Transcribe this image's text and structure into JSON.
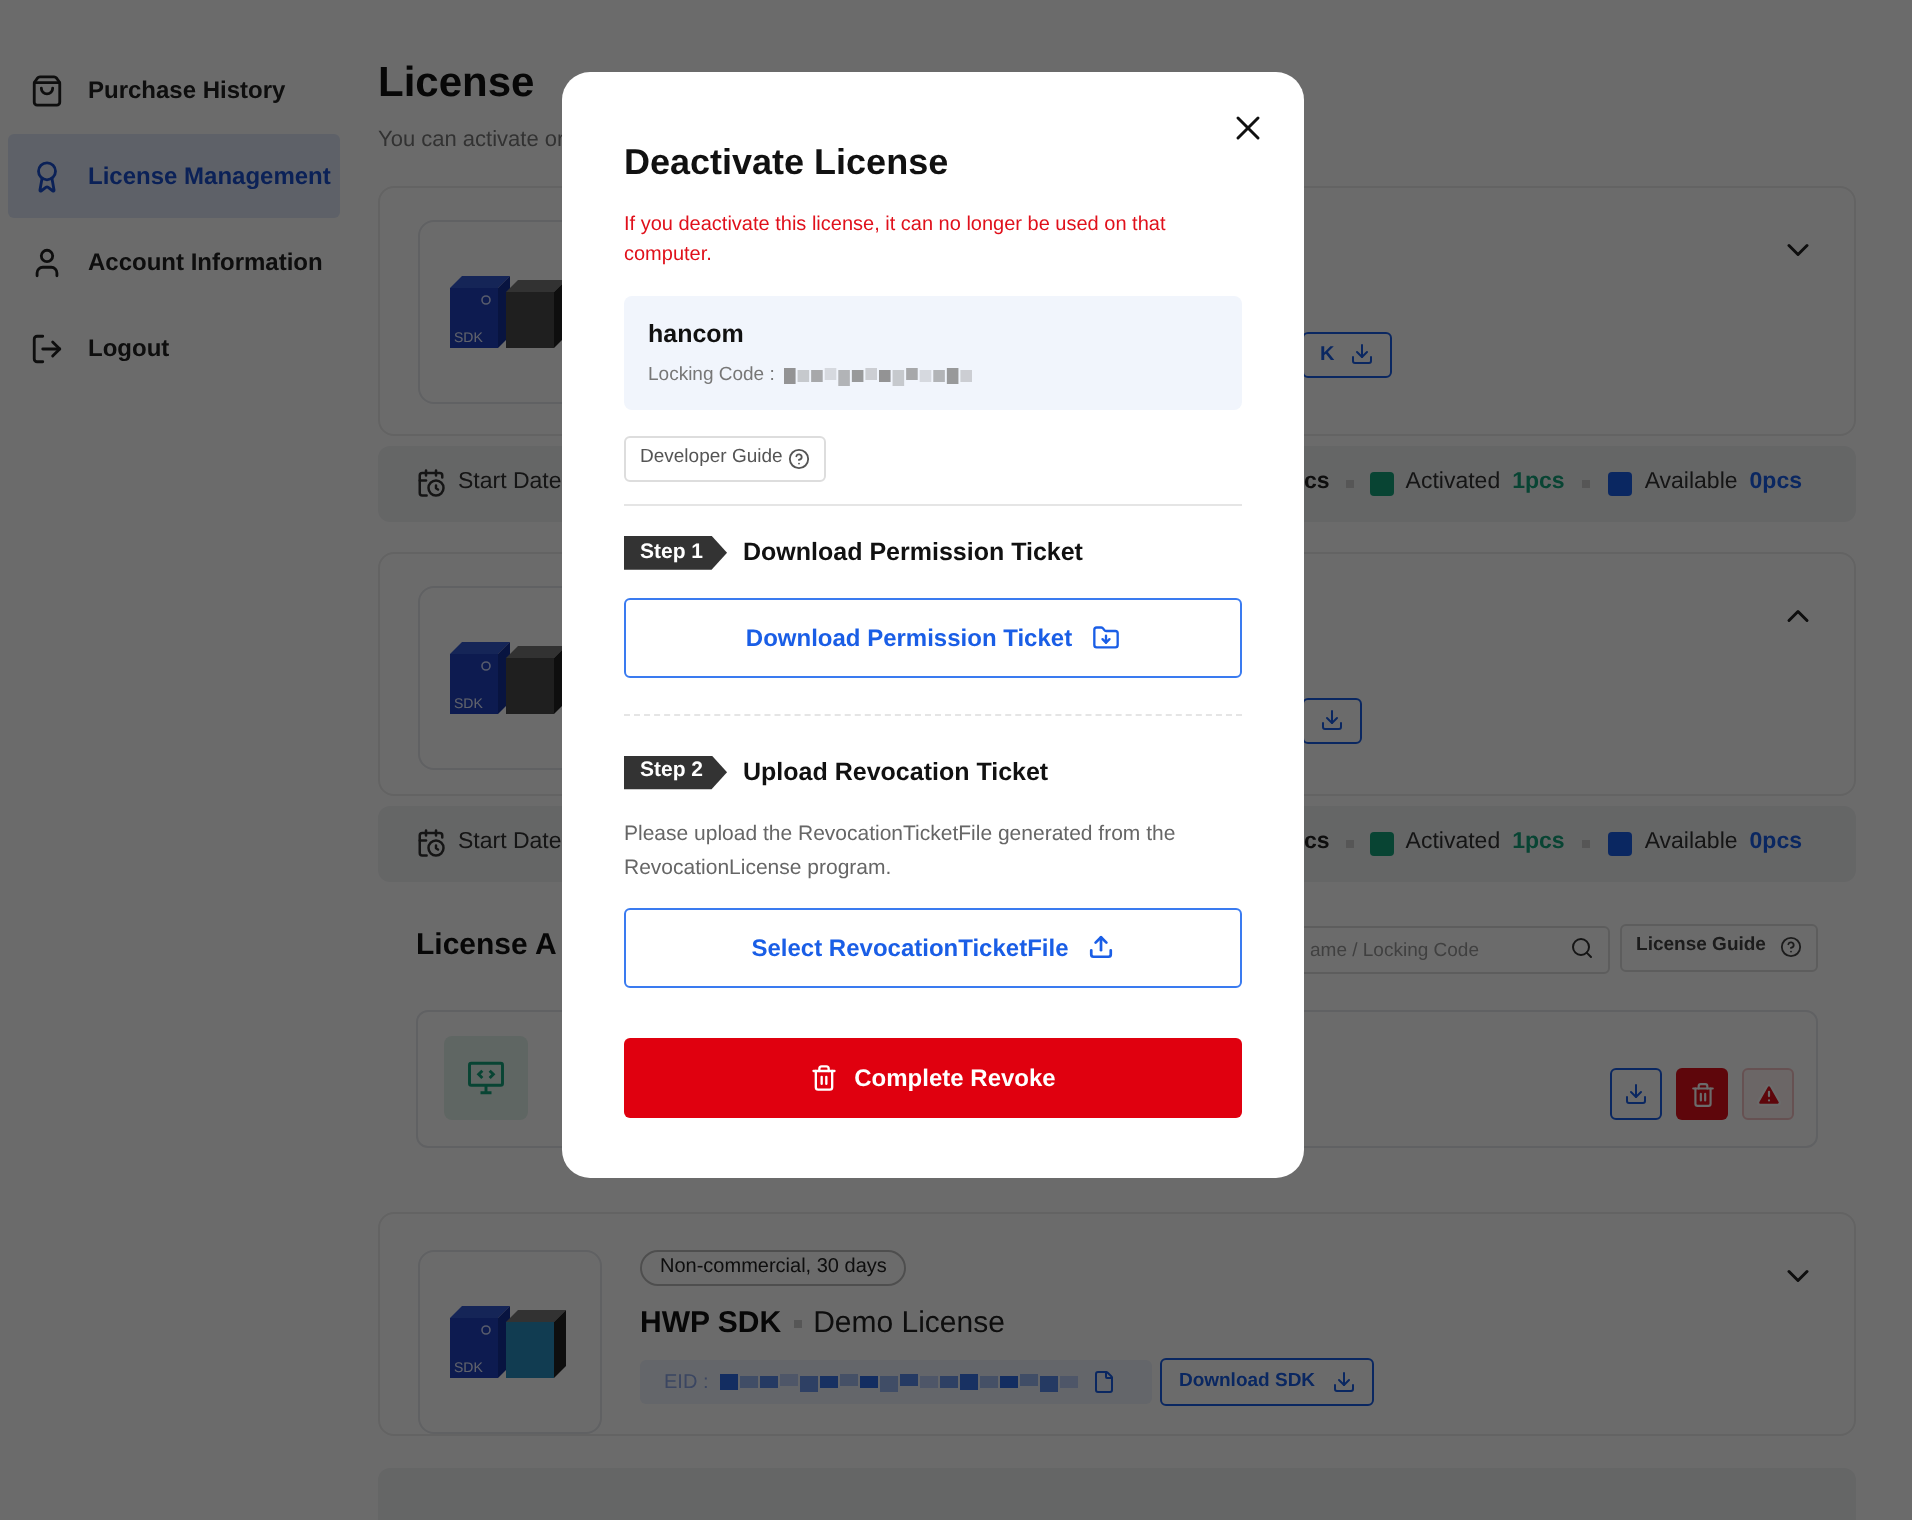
{
  "sidebar": {
    "items": [
      {
        "label": "Purchase History",
        "selected": false
      },
      {
        "label": "License Management",
        "selected": true
      },
      {
        "label": "Account Information",
        "selected": false
      },
      {
        "label": "Logout",
        "selected": false
      }
    ]
  },
  "page": {
    "title": "License",
    "subtitle": "You can activate or"
  },
  "licenses": [
    {
      "image_label": "SDK",
      "expanded": false,
      "button_label": "K",
      "stats": {
        "start_label": "Start Date",
        "total_partial": "cs",
        "activated_label": "Activated",
        "activated_count": "1pcs",
        "available_label": "Available",
        "available_count": "0pcs"
      }
    },
    {
      "image_label": "SDK",
      "expanded": true,
      "stats": {
        "start_label": "Start Date",
        "total_partial": "cs",
        "activated_label": "Activated",
        "activated_count": "1pcs",
        "available_label": "Available",
        "available_count": "0pcs"
      }
    }
  ],
  "activation": {
    "title": "License A",
    "search_placeholder": "ame / Locking Code",
    "guide_button": "License Guide"
  },
  "demo_license": {
    "image_label": "SDK",
    "expanded": false,
    "badge": "Non-commercial, 30 days",
    "product": "HWP SDK",
    "type": "Demo License",
    "eid_label": "EID :",
    "button": "Download SDK"
  },
  "modal": {
    "title": "Deactivate License",
    "warning": "If you deactivate this license, it can no longer be used on that computer.",
    "device_name": "hancom",
    "locking_label": "Locking Code :",
    "guide_button": "Developer Guide",
    "steps": [
      {
        "badge": "Step 1",
        "title": "Download Permission Ticket",
        "button": "Download Permission Ticket",
        "kind": "download"
      },
      {
        "badge": "Step 2",
        "title": "Upload Revocation Ticket",
        "description": "Please upload the RevocationTicketFile generated from the RevocationLicense program.",
        "button": "Select RevocationTicketFile",
        "kind": "upload"
      }
    ],
    "submit_button": "Complete Revoke"
  }
}
